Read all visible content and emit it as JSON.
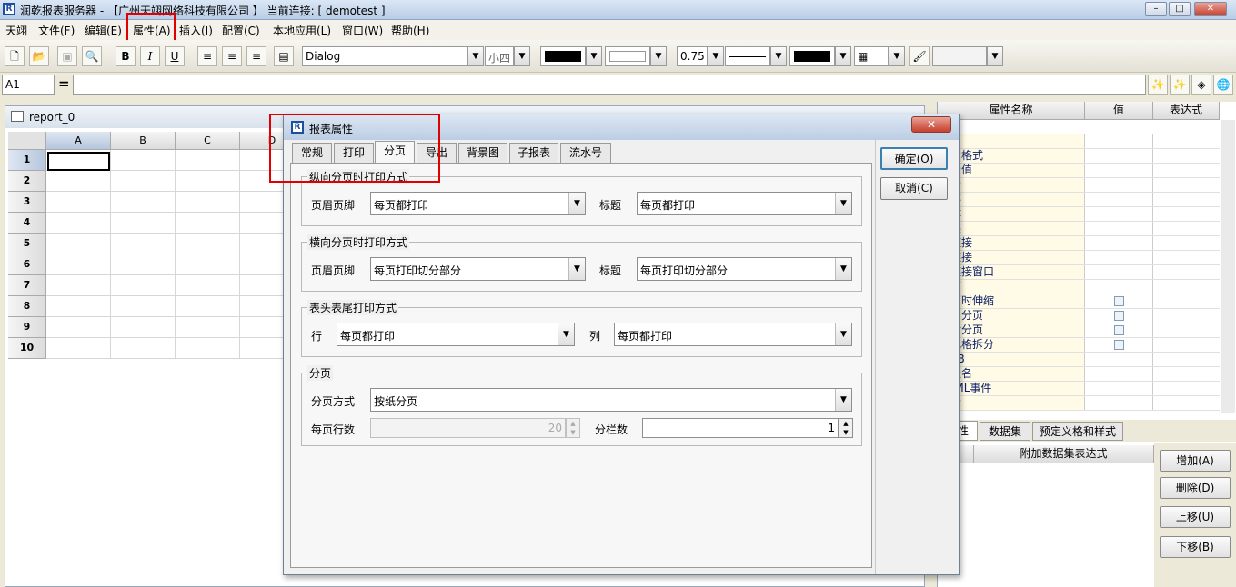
{
  "window": {
    "title": "润乾报表服务器 - 【广州天翊网络科技有限公司 】   当前连接: [ demotest ]",
    "icon": "app-logo-icon"
  },
  "menu": [
    "天翊",
    "文件(F)",
    "编辑(E)",
    "属性(A)",
    "插入(I)",
    "配置(C)",
    "本地应用(L)",
    "窗口(W)",
    "帮助(H)"
  ],
  "toolbar": {
    "font": "Dialog",
    "font_size": "小四",
    "line_width": "0.75",
    "colors": {
      "font": "#000000",
      "background": "#ffffff",
      "border": "#000000"
    }
  },
  "formula": {
    "cell_ref": "A1",
    "equals": "=",
    "value": ""
  },
  "sheet": {
    "title": "report_0",
    "columns": [
      "A",
      "B",
      "C",
      "D"
    ],
    "rows": [
      "1",
      "2",
      "3",
      "4",
      "5",
      "6",
      "7",
      "8",
      "9",
      "10"
    ]
  },
  "props": {
    "headers": [
      "属性名称",
      "值",
      "表达式"
    ],
    "items": [
      "值",
      "显示格式",
      "显示值",
      "提示",
      "段落",
      "字体",
      "扩展",
      "超链接",
      "超链接",
      "超链接窗口",
      "分页",
      "分页时伸缩",
      "行后分页",
      "列后分页",
      "单元格拆分",
      "WEB",
      "变量名",
      "HTML事件",
      "提示"
    ],
    "tabs": [
      "属性",
      "数据集",
      "预定义格和样式"
    ],
    "dataset_headers": [
      "号",
      "附加数据集表达式"
    ],
    "buttons": [
      "增加(A)",
      "删除(D)",
      "上移(U)",
      "下移(B)"
    ]
  },
  "dialog": {
    "title": "报表属性",
    "tabs": [
      "常规",
      "打印",
      "分页",
      "导出",
      "背景图",
      "子报表",
      "流水号"
    ],
    "active_tab": "分页",
    "ok": "确定(O)",
    "cancel": "取消(C)",
    "vertical": {
      "title": "纵向分页时打印方式",
      "header_label": "页眉页脚",
      "header_value": "每页都打印",
      "title_label": "标题",
      "title_value": "每页都打印"
    },
    "horizontal": {
      "title": "横向分页时打印方式",
      "header_label": "页眉页脚",
      "header_value": "每页打印切分部分",
      "title_label": "标题",
      "title_value": "每页打印切分部分"
    },
    "headtail": {
      "title": "表头表尾打印方式",
      "row_label": "行",
      "row_value": "每页都打印",
      "col_label": "列",
      "col_value": "每页都打印"
    },
    "paging": {
      "title": "分页",
      "mode_label": "分页方式",
      "mode_value": "按纸分页",
      "rows_label": "每页行数",
      "rows_value": "20",
      "cols_label": "分栏数",
      "cols_value": "1"
    }
  }
}
